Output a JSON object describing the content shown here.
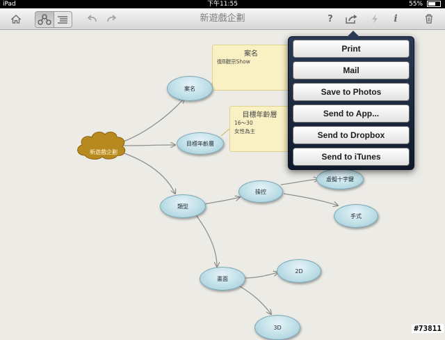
{
  "status_bar": {
    "device": "iPad",
    "time": "下午11:55",
    "battery": "55%"
  },
  "toolbar": {
    "title": "新遊戲企劃",
    "icons": [
      "home-icon",
      "mindmap-view-icon",
      "outline-view-icon",
      "undo-icon",
      "redo-icon",
      "help-icon",
      "share-icon",
      "lightning-icon",
      "info-icon",
      "trash-icon"
    ],
    "help_label": "?",
    "info_label": "i"
  },
  "mind_map": {
    "root": "新遊戲企劃",
    "nodes": {
      "case_name": "案名",
      "target_age": "目標年齡層",
      "genre": "類型",
      "controls": "操控",
      "virtual_dpad": "虛擬十字鍵",
      "hand": "手式",
      "graphics": "畫面",
      "g2d": "2D",
      "g3d": "3D"
    },
    "notes": {
      "case_name": {
        "title": "案名",
        "lines": [
          "復B觀宗Show"
        ]
      },
      "target_age": {
        "title": "目標年齡層",
        "lines": [
          "16～30",
          "女性為主"
        ]
      }
    }
  },
  "share_menu": {
    "items": [
      "Print",
      "Mail",
      "Save to Photos",
      "Send to App...",
      "Send to Dropbox",
      "Send to iTunes"
    ]
  },
  "watermark": "#73811",
  "colors": {
    "node_fill": "#bcdde6",
    "root_fill": "#b8891f",
    "note_fill": "#f9f1c4",
    "popover": "#1b2740"
  }
}
